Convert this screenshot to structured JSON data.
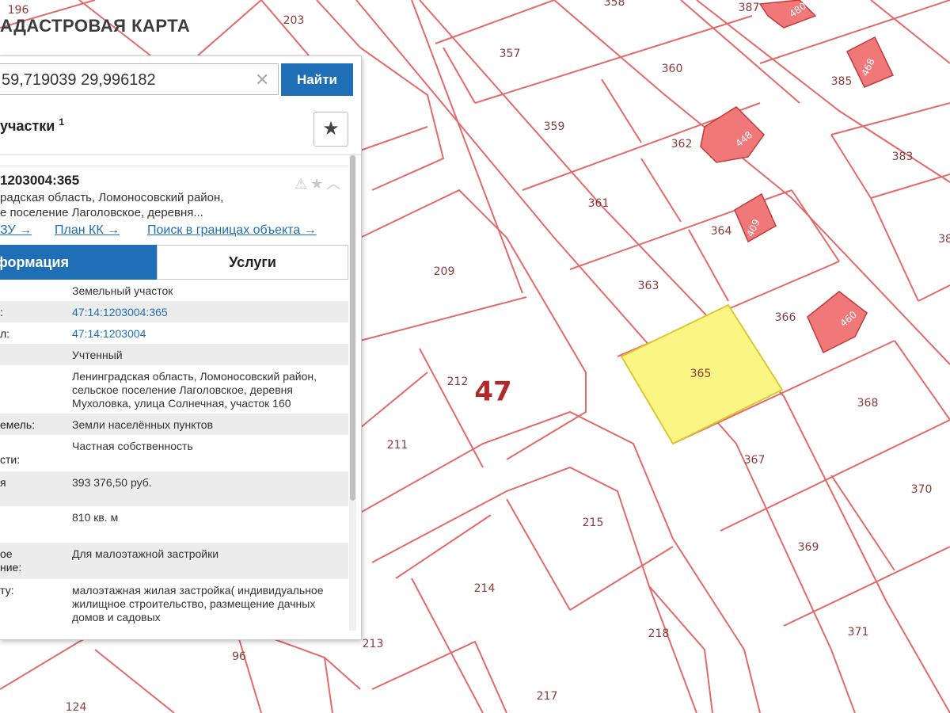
{
  "header": {
    "title": "АДАСТРОВАЯ КАРТА"
  },
  "search": {
    "value": "59,719039 29,996182",
    "clear_icon": "close-icon",
    "button_label": "Найти"
  },
  "results": {
    "title": "участки",
    "count": "1",
    "favorite_icon": "star-icon"
  },
  "parcel": {
    "number": "1203004:365",
    "warning_icon": "warning-icon",
    "star_icon": "star-icon",
    "collapse_icon": "chevron-up-icon",
    "address_lines": [
      "радская область, Ломоносовский район,",
      "е поселение Лаголовское, деревня..."
    ],
    "links": [
      "ЗУ →",
      "План КК →",
      "Поиск в границах объекта →"
    ],
    "tabs": {
      "info": "формация",
      "services": "Услуги"
    },
    "rows": [
      {
        "key": "",
        "value": "Земельный участок",
        "link": false
      },
      {
        "key": ":",
        "value": "47:14:1203004:365",
        "link": true
      },
      {
        "key": "л:",
        "value": "47:14:1203004",
        "link": true
      },
      {
        "key": "",
        "value": "Учтенный",
        "link": false
      },
      {
        "key": "",
        "value": "Ленинградская область, Ломоносовский район, сельское поселение Лаголовское, деревня Мухоловка, улица Солнечная, участок 160",
        "link": false
      },
      {
        "key": "емель:",
        "value": "Земли населённых пунктов",
        "link": false
      },
      {
        "key": "\nсти:",
        "value": "Частная собственность",
        "link": false
      },
      {
        "key": "я",
        "value": "393 376,50 руб.",
        "link": false
      },
      {
        "key": "",
        "value": "810 кв. м",
        "link": false
      },
      {
        "key": "ое\nние:",
        "value": "Для малоэтажной застройки",
        "link": false
      },
      {
        "key": "ту:",
        "value": "малоэтажная жилая застройка( индивидуальное жилищное строительство, размещение дачных домов и садовых",
        "link": false
      }
    ]
  },
  "map": {
    "colors": {
      "boundary": "#e46a6a",
      "building_fill": "#f07878",
      "selected_fill": "#fbf683",
      "label": "#8a3b3b"
    },
    "quarter_label": "47",
    "selected_parcel": "365",
    "parcel_labels": [
      "196",
      "203",
      "358",
      "387",
      "357",
      "360",
      "385",
      "359",
      "362",
      "383",
      "361",
      "364",
      "38",
      "209",
      "363",
      "366",
      "365",
      "212",
      "368",
      "211",
      "367",
      "370",
      "215",
      "369",
      "214",
      "218",
      "371",
      "213",
      "96",
      "217",
      "124"
    ],
    "building_labels": [
      "480",
      "468",
      "448",
      "409",
      "460"
    ]
  }
}
